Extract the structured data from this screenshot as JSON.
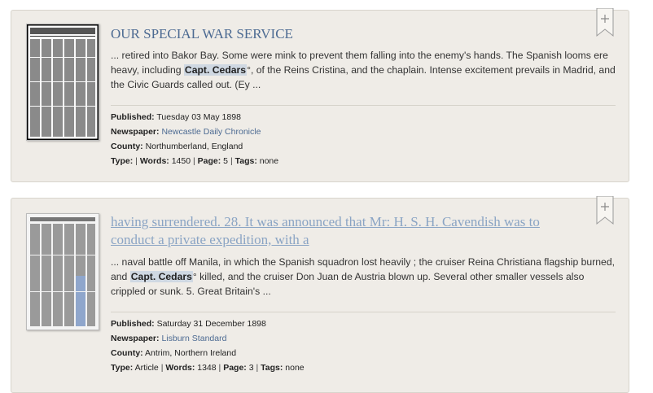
{
  "results": [
    {
      "title": "OUR SPECIAL WAR SERVICE",
      "snippet_before": "... retired into Bakor Bay. Some were mink to prevent them falling into the enemy's hands. The Spanish looms ere heavy, including ",
      "snippet_highlight": "Capt. Cedars",
      "snippet_after": "°, of the Reins Cristina, and the chaplain. Intense excitement prevails in Madrid, and the Civic Guards called out. (Ey ...",
      "published_label": "Published:",
      "published": "Tuesday 03 May 1898",
      "newspaper_label": "Newspaper:",
      "newspaper": "Newcastle Daily Chronicle",
      "county_label": "County:",
      "county": "Northumberland, England",
      "type_label": "Type:",
      "type": "",
      "words_label": "Words:",
      "words": "1450",
      "page_label": "Page:",
      "page": "5",
      "tags_label": "Tags:",
      "tags": "none"
    },
    {
      "title": "having surrendered. 28. It was announced that Mr: H. S. H. Cavendish was to conduct a private expedition, with a",
      "snippet_before": "... naval battle off Manila, in which the Spanish squadron lost heavily ; the cruiser Reina Christiana flagship burned, and ",
      "snippet_highlight": "Capt. Cedars",
      "snippet_after": "° killed, and the cruiser Don Juan de Austria blown up. Several other smaller vessels also crippled or sunk. 5. Great Britain's ...",
      "published_label": "Published:",
      "published": "Saturday 31 December 1898",
      "newspaper_label": "Newspaper:",
      "newspaper": "Lisburn Standard",
      "county_label": "County:",
      "county": "Antrim, Northern Ireland",
      "type_label": "Type:",
      "type": "Article",
      "words_label": "Words:",
      "words": "1348",
      "page_label": "Page:",
      "page": "3",
      "tags_label": "Tags:",
      "tags": "none"
    }
  ],
  "colors": {
    "card_bg": "#efece7",
    "link": "#4c6a92",
    "visited_link": "#8aa4c4",
    "highlight": "#cfd8e2"
  }
}
